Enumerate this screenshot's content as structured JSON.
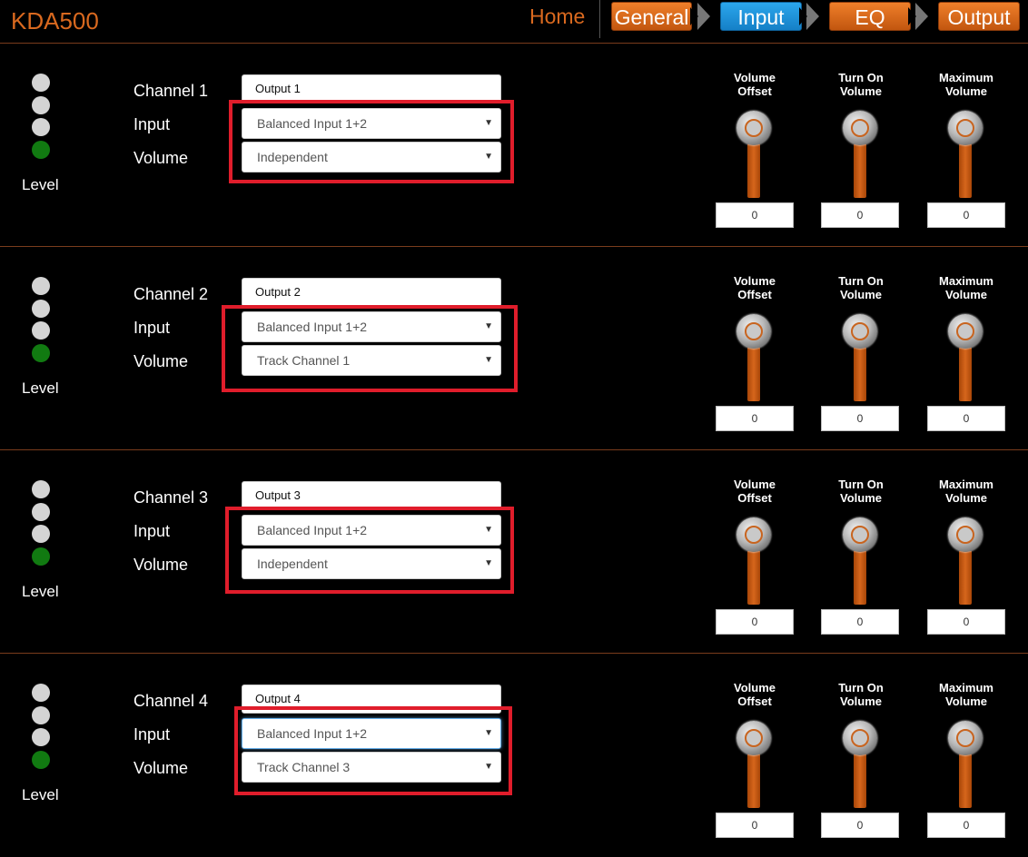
{
  "header": {
    "brand": "KDA500",
    "home": "Home",
    "tabs": [
      {
        "label": "General",
        "active": false
      },
      {
        "label": "Input",
        "active": true
      },
      {
        "label": "EQ",
        "active": false
      },
      {
        "label": "Output",
        "active": false
      }
    ]
  },
  "labels": {
    "input": "Input",
    "volume": "Volume",
    "level": "Level",
    "volume_offset": "Volume\nOffset",
    "turn_on_volume": "Turn On\nVolume",
    "maximum_volume": "Maximum\nVolume"
  },
  "colors": {
    "accent_orange": "#d9691f",
    "active_blue": "#1580c7",
    "highlight_red": "#e01d2b",
    "led_on": "#117a11",
    "led_off": "#d4d4d4"
  },
  "channels": [
    {
      "title": "Channel 1",
      "name": "Output 1",
      "input": "Balanced Input 1+2",
      "volume_mode": "Independent",
      "volume_offset": "0",
      "turn_on_volume": "0",
      "maximum_volume": "0"
    },
    {
      "title": "Channel 2",
      "name": "Output 2",
      "input": "Balanced Input 1+2",
      "volume_mode": "Track Channel 1",
      "volume_offset": "0",
      "turn_on_volume": "0",
      "maximum_volume": "0"
    },
    {
      "title": "Channel 3",
      "name": "Output 3",
      "input": "Balanced Input 1+2",
      "volume_mode": "Independent",
      "volume_offset": "0",
      "turn_on_volume": "0",
      "maximum_volume": "0"
    },
    {
      "title": "Channel 4",
      "name": "Output 4",
      "input": "Balanced Input 1+2",
      "volume_mode": "Track Channel 3",
      "volume_offset": "0",
      "turn_on_volume": "0",
      "maximum_volume": "0"
    }
  ]
}
